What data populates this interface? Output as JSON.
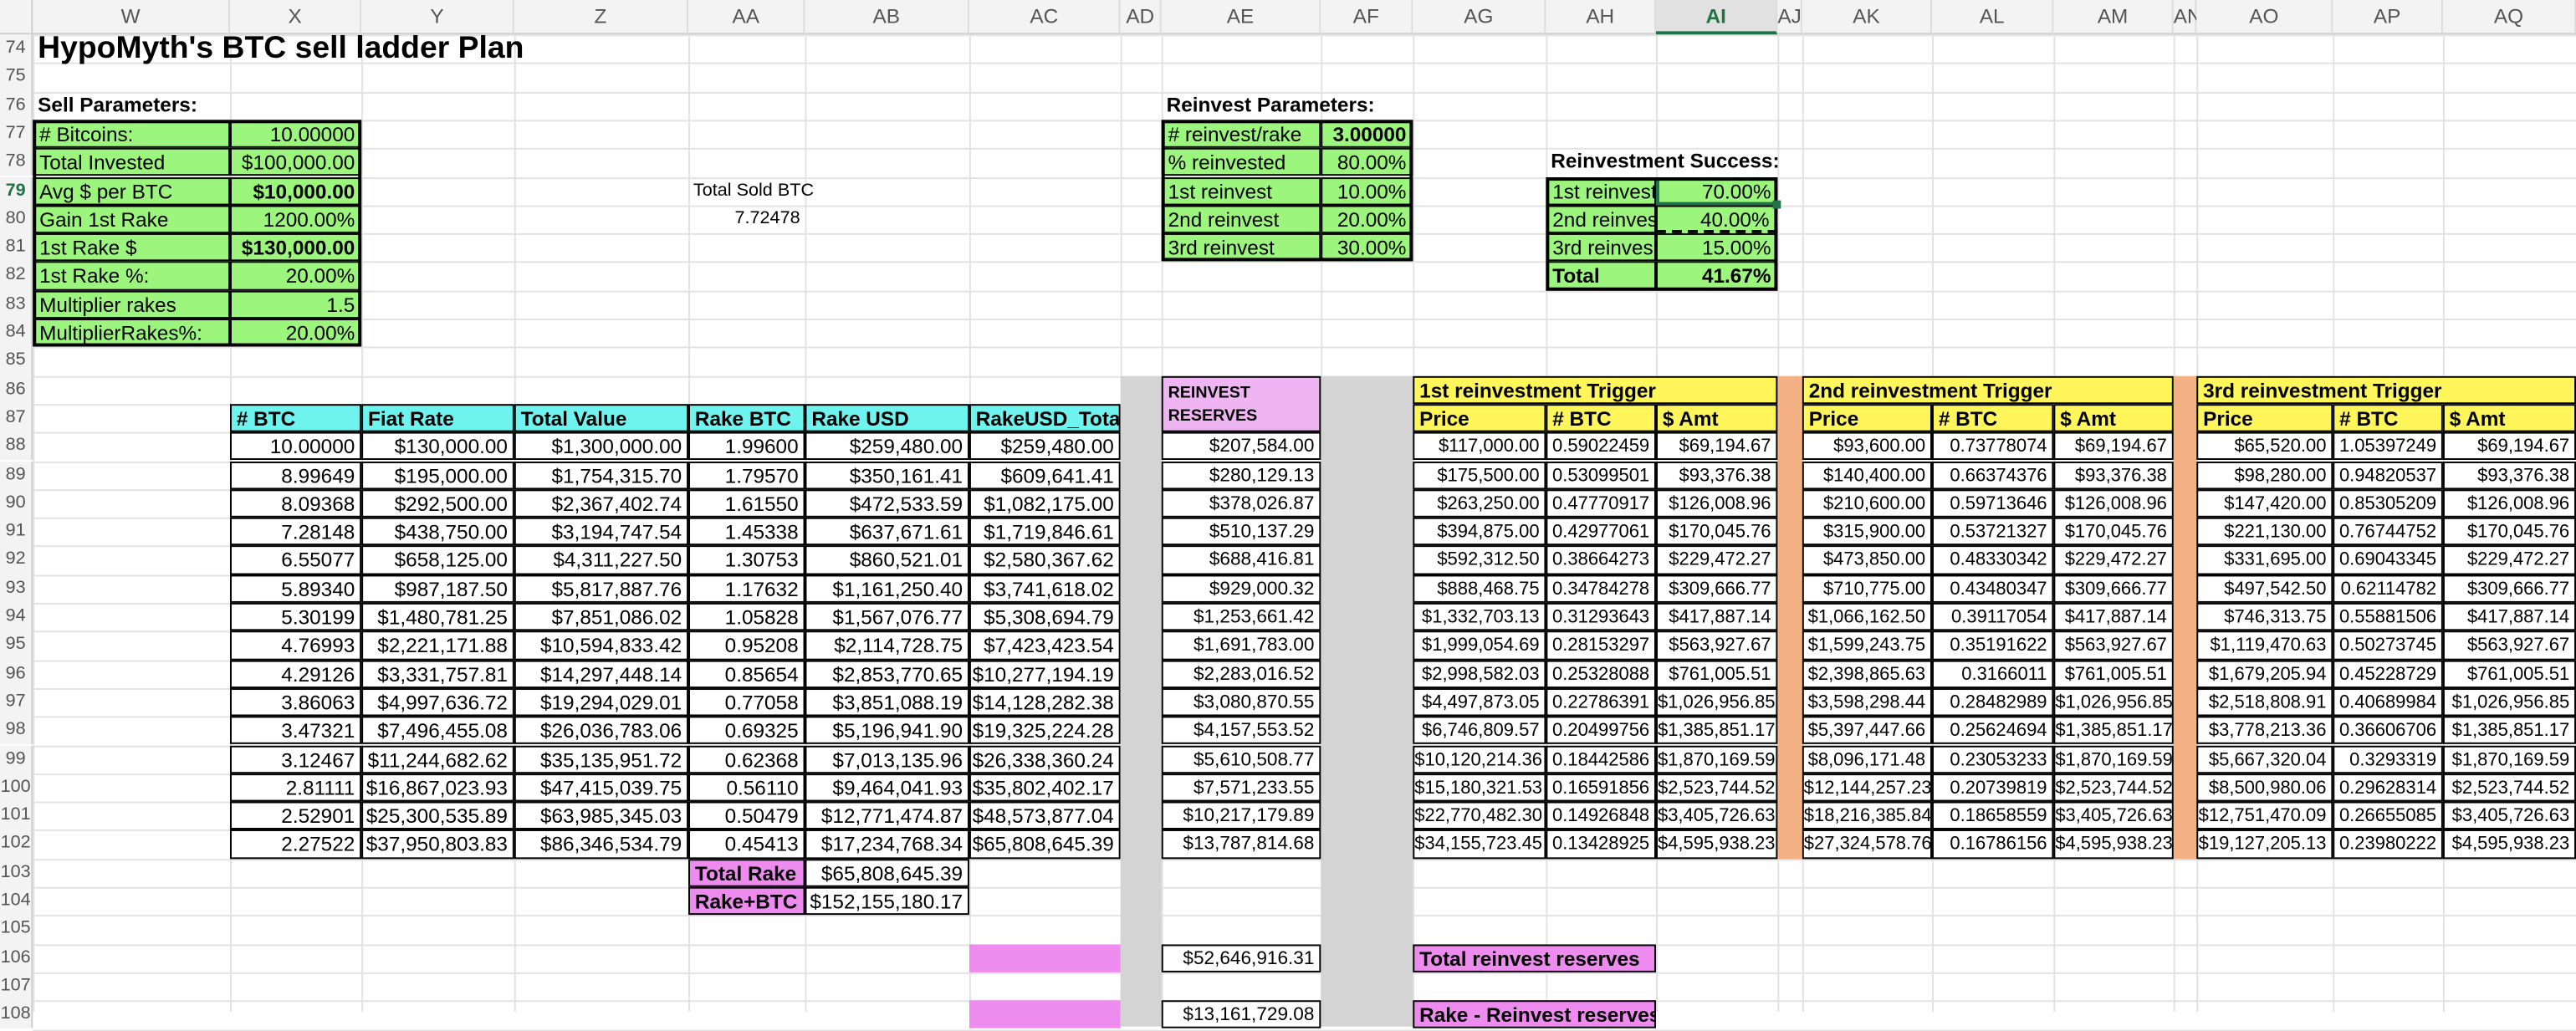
{
  "columns": [
    "W",
    "X",
    "Y",
    "Z",
    "AA",
    "AB",
    "AC",
    "AD",
    "AE",
    "AF",
    "AG",
    "AH",
    "AI",
    "AJ",
    "AK",
    "AL",
    "AM",
    "AN",
    "AO",
    "AP",
    "AQ"
  ],
  "selected_column": "AI",
  "rows": [
    "74",
    "75",
    "76",
    "77",
    "78",
    "79",
    "80",
    "81",
    "82",
    "83",
    "84",
    "85",
    "86",
    "87",
    "88",
    "89",
    "90",
    "91",
    "92",
    "93",
    "94",
    "95",
    "96",
    "97",
    "98",
    "99",
    "100",
    "101",
    "102",
    "103",
    "104",
    "105",
    "106",
    "107",
    "108"
  ],
  "selected_row": "79",
  "title": "HypoMyth's BTC sell ladder Plan",
  "sell_params": {
    "header": "Sell Parameters:",
    "items": [
      {
        "label": "# Bitcoins:",
        "value": "10.00000"
      },
      {
        "label": "Total Invested",
        "value": "$100,000.00"
      },
      {
        "label": "Avg $ per BTC",
        "value": "$10,000.00"
      },
      {
        "label": "Gain 1st Rake",
        "value": "1200.00%"
      },
      {
        "label": "1st Rake $",
        "value": "$130,000.00"
      },
      {
        "label": "1st Rake %:",
        "value": "20.00%"
      },
      {
        "label": "Multiplier rakes",
        "value": "1.5"
      },
      {
        "label": "MultiplierRakes%:",
        "value": "20.00%"
      }
    ]
  },
  "total_sold": {
    "label": "Total Sold BTC",
    "value": "7.72478"
  },
  "reinvest_params": {
    "header": "Reinvest Parameters:",
    "items": [
      {
        "label": "# reinvest/rake",
        "value": "3.00000"
      },
      {
        "label": "% reinvested",
        "value": "80.00%"
      },
      {
        "label": "1st reinvest",
        "value": "10.00%"
      },
      {
        "label": "2nd reinvest",
        "value": "20.00%"
      },
      {
        "label": "3rd reinvest",
        "value": "30.00%"
      }
    ]
  },
  "reinvest_success": {
    "header": "Reinvestment Success:",
    "items": [
      {
        "label": "1st reinvest",
        "value": "70.00%"
      },
      {
        "label": "2nd reinves",
        "value": "40.00%"
      },
      {
        "label": "3rd reinves",
        "value": "15.00%"
      }
    ],
    "total_label": "Total",
    "total_value": "41.67%"
  },
  "main_table": {
    "headers": [
      "# BTC",
      "Fiat Rate",
      "Total Value",
      "Rake BTC",
      "Rake USD",
      "RakeUSD_Total"
    ],
    "rows": [
      [
        "10.00000",
        "$130,000.00",
        "$1,300,000.00",
        "1.99600",
        "$259,480.00",
        "$259,480.00"
      ],
      [
        "8.99649",
        "$195,000.00",
        "$1,754,315.70",
        "1.79570",
        "$350,161.41",
        "$609,641.41"
      ],
      [
        "8.09368",
        "$292,500.00",
        "$2,367,402.74",
        "1.61550",
        "$472,533.59",
        "$1,082,175.00"
      ],
      [
        "7.28148",
        "$438,750.00",
        "$3,194,747.54",
        "1.45338",
        "$637,671.61",
        "$1,719,846.61"
      ],
      [
        "6.55077",
        "$658,125.00",
        "$4,311,227.50",
        "1.30753",
        "$860,521.01",
        "$2,580,367.62"
      ],
      [
        "5.89340",
        "$987,187.50",
        "$5,817,887.76",
        "1.17632",
        "$1,161,250.40",
        "$3,741,618.02"
      ],
      [
        "5.30199",
        "$1,480,781.25",
        "$7,851,086.02",
        "1.05828",
        "$1,567,076.77",
        "$5,308,694.79"
      ],
      [
        "4.76993",
        "$2,221,171.88",
        "$10,594,833.42",
        "0.95208",
        "$2,114,728.75",
        "$7,423,423.54"
      ],
      [
        "4.29126",
        "$3,331,757.81",
        "$14,297,448.14",
        "0.85654",
        "$2,853,770.65",
        "$10,277,194.19"
      ],
      [
        "3.86063",
        "$4,997,636.72",
        "$19,294,029.01",
        "0.77058",
        "$3,851,088.19",
        "$14,128,282.38"
      ],
      [
        "3.47321",
        "$7,496,455.08",
        "$26,036,783.06",
        "0.69325",
        "$5,196,941.90",
        "$19,325,224.28"
      ],
      [
        "3.12467",
        "$11,244,682.62",
        "$35,135,951.72",
        "0.62368",
        "$7,013,135.96",
        "$26,338,360.24"
      ],
      [
        "2.81111",
        "$16,867,023.93",
        "$47,415,039.75",
        "0.56110",
        "$9,464,041.93",
        "$35,802,402.17"
      ],
      [
        "2.52901",
        "$25,300,535.89",
        "$63,985,345.03",
        "0.50479",
        "$12,771,474.87",
        "$48,573,877.04"
      ],
      [
        "2.27522",
        "$37,950,803.83",
        "$86,346,534.79",
        "0.45413",
        "$17,234,768.34",
        "$65,808,645.39"
      ]
    ],
    "total_rake_label": "Total Rake",
    "total_rake_value": "$65,808,645.39",
    "rake_btc_label": "Rake+BTC",
    "rake_btc_value": "$152,155,180.17"
  },
  "reserves": {
    "header": "REINVEST RESERVES",
    "values": [
      "$207,584.00",
      "$280,129.13",
      "$378,026.87",
      "$510,137.29",
      "$688,416.81",
      "$929,000.32",
      "$1,253,661.42",
      "$1,691,783.00",
      "$2,283,016.52",
      "$3,080,870.55",
      "$4,157,553.52",
      "$5,610,508.77",
      "$7,571,233.55",
      "$10,217,179.89",
      "$13,787,814.68"
    ],
    "total": "$52,646,916.31",
    "net": "$13,161,729.08",
    "total_label": "Total reinvest reserves",
    "net_label": "Rake - Reinvest reserves"
  },
  "triggers": [
    {
      "title": "1st reinvestment Trigger",
      "headers": [
        "Price",
        "# BTC",
        "$ Amt"
      ],
      "rows": [
        [
          "$117,000.00",
          "0.59022459",
          "$69,194.67"
        ],
        [
          "$175,500.00",
          "0.53099501",
          "$93,376.38"
        ],
        [
          "$263,250.00",
          "0.47770917",
          "$126,008.96"
        ],
        [
          "$394,875.00",
          "0.42977061",
          "$170,045.76"
        ],
        [
          "$592,312.50",
          "0.38664273",
          "$229,472.27"
        ],
        [
          "$888,468.75",
          "0.34784278",
          "$309,666.77"
        ],
        [
          "$1,332,703.13",
          "0.31293643",
          "$417,887.14"
        ],
        [
          "$1,999,054.69",
          "0.28153297",
          "$563,927.67"
        ],
        [
          "$2,998,582.03",
          "0.25328088",
          "$761,005.51"
        ],
        [
          "$4,497,873.05",
          "0.22786391",
          "$1,026,956.85"
        ],
        [
          "$6,746,809.57",
          "0.20499756",
          "$1,385,851.17"
        ],
        [
          "$10,120,214.36",
          "0.18442586",
          "$1,870,169.59"
        ],
        [
          "$15,180,321.53",
          "0.16591856",
          "$2,523,744.52"
        ],
        [
          "$22,770,482.30",
          "0.14926848",
          "$3,405,726.63"
        ],
        [
          "$34,155,723.45",
          "0.13428925",
          "$4,595,938.23"
        ]
      ]
    },
    {
      "title": "2nd reinvestment Trigger",
      "headers": [
        "Price",
        "# BTC",
        "$ Amt"
      ],
      "rows": [
        [
          "$93,600.00",
          "0.73778074",
          "$69,194.67"
        ],
        [
          "$140,400.00",
          "0.66374376",
          "$93,376.38"
        ],
        [
          "$210,600.00",
          "0.59713646",
          "$126,008.96"
        ],
        [
          "$315,900.00",
          "0.53721327",
          "$170,045.76"
        ],
        [
          "$473,850.00",
          "0.48330342",
          "$229,472.27"
        ],
        [
          "$710,775.00",
          "0.43480347",
          "$309,666.77"
        ],
        [
          "$1,066,162.50",
          "0.39117054",
          "$417,887.14"
        ],
        [
          "$1,599,243.75",
          "0.35191622",
          "$563,927.67"
        ],
        [
          "$2,398,865.63",
          "0.3166011",
          "$761,005.51"
        ],
        [
          "$3,598,298.44",
          "0.28482989",
          "$1,026,956.85"
        ],
        [
          "$5,397,447.66",
          "0.25624694",
          "$1,385,851.17"
        ],
        [
          "$8,096,171.48",
          "0.23053233",
          "$1,870,169.59"
        ],
        [
          "$12,144,257.23",
          "0.20739819",
          "$2,523,744.52"
        ],
        [
          "$18,216,385.84",
          "0.18658559",
          "$3,405,726.63"
        ],
        [
          "$27,324,578.76",
          "0.16786156",
          "$4,595,938.23"
        ]
      ]
    },
    {
      "title": "3rd reinvestment Trigger",
      "headers": [
        "Price",
        "# BTC",
        "$ Amt"
      ],
      "rows": [
        [
          "$65,520.00",
          "1.05397249",
          "$69,194.67"
        ],
        [
          "$98,280.00",
          "0.94820537",
          "$93,376.38"
        ],
        [
          "$147,420.00",
          "0.85305209",
          "$126,008.96"
        ],
        [
          "$221,130.00",
          "0.76744752",
          "$170,045.76"
        ],
        [
          "$331,695.00",
          "0.69043345",
          "$229,472.27"
        ],
        [
          "$497,542.50",
          "0.62114782",
          "$309,666.77"
        ],
        [
          "$746,313.75",
          "0.55881506",
          "$417,887.14"
        ],
        [
          "$1,119,470.63",
          "0.50273745",
          "$563,927.67"
        ],
        [
          "$1,679,205.94",
          "0.45228729",
          "$761,005.51"
        ],
        [
          "$2,518,808.91",
          "0.40689984",
          "$1,026,956.85"
        ],
        [
          "$3,778,213.36",
          "0.36606706",
          "$1,385,851.17"
        ],
        [
          "$5,667,320.04",
          "0.3293319",
          "$1,870,169.59"
        ],
        [
          "$8,500,980.06",
          "0.29628314",
          "$2,523,744.52"
        ],
        [
          "$12,751,470.09",
          "0.26655085",
          "$3,405,726.63"
        ],
        [
          "$19,127,205.13",
          "0.23980222",
          "$4,595,938.23"
        ]
      ]
    }
  ],
  "colors": {
    "param_fill": "#9cf57c",
    "table_header_fill": "#6ff3ef",
    "trigger_header_fill": "#fef65b",
    "rake_label_fill": "#ee8bef",
    "reserve_header_fill": "#efb5f3",
    "spacer_fill": "#d4d4d4",
    "separator_fill": "#f4b183",
    "selection": "#217346"
  }
}
